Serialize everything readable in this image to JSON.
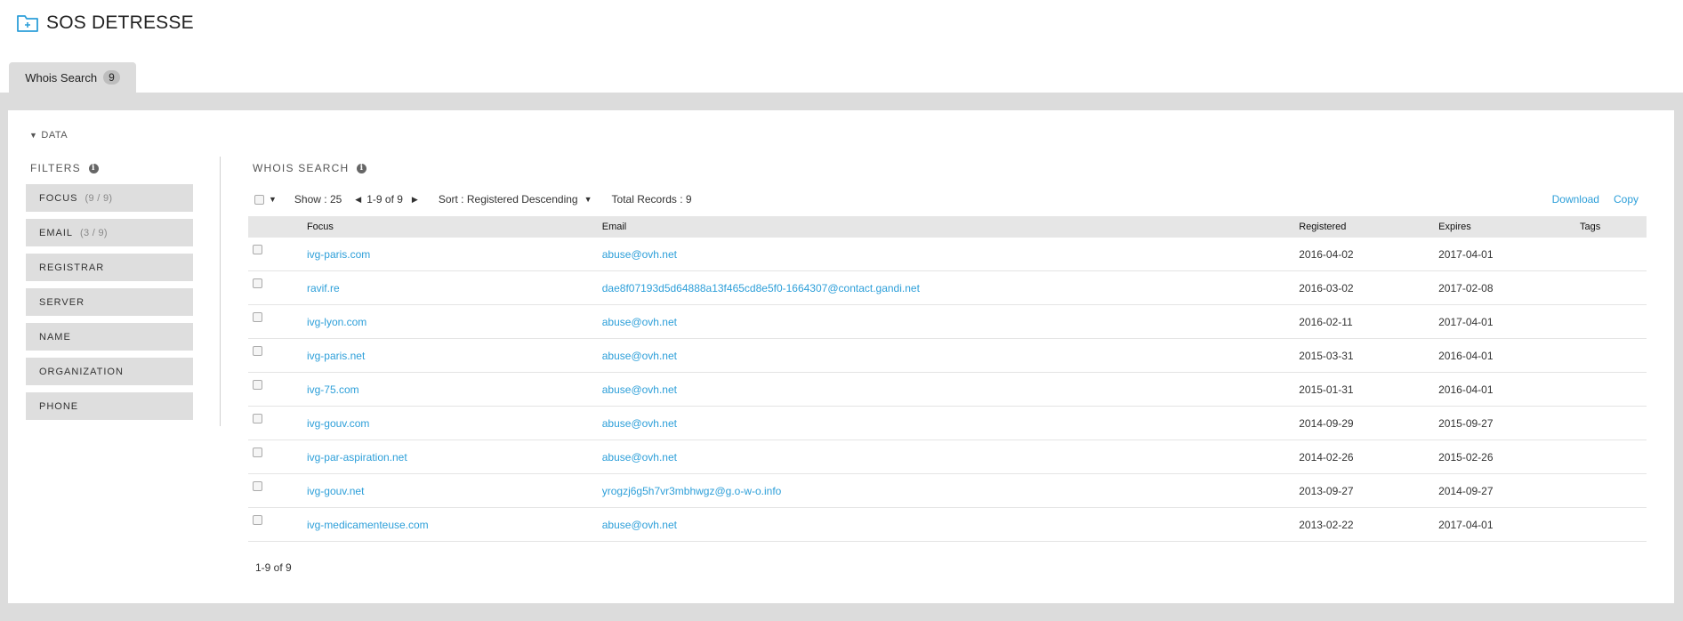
{
  "app": {
    "title": "SOS DETRESSE"
  },
  "tab": {
    "label": "Whois Search",
    "count": "9"
  },
  "data_toggle": {
    "label": "DATA"
  },
  "filters": {
    "title": "FILTERS",
    "items": [
      {
        "label": "FOCUS",
        "count": "(9 / 9)"
      },
      {
        "label": "EMAIL",
        "count": "(3 / 9)"
      },
      {
        "label": "REGISTRAR",
        "count": ""
      },
      {
        "label": "SERVER",
        "count": ""
      },
      {
        "label": "NAME",
        "count": ""
      },
      {
        "label": "ORGANIZATION",
        "count": ""
      },
      {
        "label": "PHONE",
        "count": ""
      }
    ]
  },
  "search": {
    "title": "WHOIS SEARCH",
    "show": "Show : 25",
    "range": "1-9 of 9",
    "sort": "Sort : Registered Descending",
    "total": "Total Records : 9",
    "download": "Download",
    "copy": "Copy",
    "footer": "1-9 of 9"
  },
  "table": {
    "headers": [
      "Focus",
      "Email",
      "Registered",
      "Expires",
      "Tags"
    ],
    "rows": [
      {
        "focus": "ivg-paris.com",
        "email": "abuse@ovh.net",
        "registered": "2016-04-02",
        "expires": "2017-04-01",
        "tags": ""
      },
      {
        "focus": "ravif.re",
        "email": "dae8f07193d5d64888a13f465cd8e5f0-1664307@contact.gandi.net",
        "registered": "2016-03-02",
        "expires": "2017-02-08",
        "tags": ""
      },
      {
        "focus": "ivg-lyon.com",
        "email": "abuse@ovh.net",
        "registered": "2016-02-11",
        "expires": "2017-04-01",
        "tags": ""
      },
      {
        "focus": "ivg-paris.net",
        "email": "abuse@ovh.net",
        "registered": "2015-03-31",
        "expires": "2016-04-01",
        "tags": ""
      },
      {
        "focus": "ivg-75.com",
        "email": "abuse@ovh.net",
        "registered": "2015-01-31",
        "expires": "2016-04-01",
        "tags": ""
      },
      {
        "focus": "ivg-gouv.com",
        "email": "abuse@ovh.net",
        "registered": "2014-09-29",
        "expires": "2015-09-27",
        "tags": ""
      },
      {
        "focus": "ivg-par-aspiration.net",
        "email": "abuse@ovh.net",
        "registered": "2014-02-26",
        "expires": "2015-02-26",
        "tags": ""
      },
      {
        "focus": "ivg-gouv.net",
        "email": "yrogzj6g5h7vr3mbhwgz@g.o-w-o.info",
        "registered": "2013-09-27",
        "expires": "2014-09-27",
        "tags": ""
      },
      {
        "focus": "ivg-medicamenteuse.com",
        "email": "abuse@ovh.net",
        "registered": "2013-02-22",
        "expires": "2017-04-01",
        "tags": ""
      }
    ]
  },
  "colors": {
    "accent": "#2d9fd9",
    "band": "#dcdcdc",
    "filter_bg": "#dedede",
    "header_bg": "#e6e6e6"
  },
  "icons": {
    "app": "folder-plus-icon",
    "info": "info-icon",
    "prev": "triangle-left-icon",
    "next": "triangle-right-icon"
  }
}
